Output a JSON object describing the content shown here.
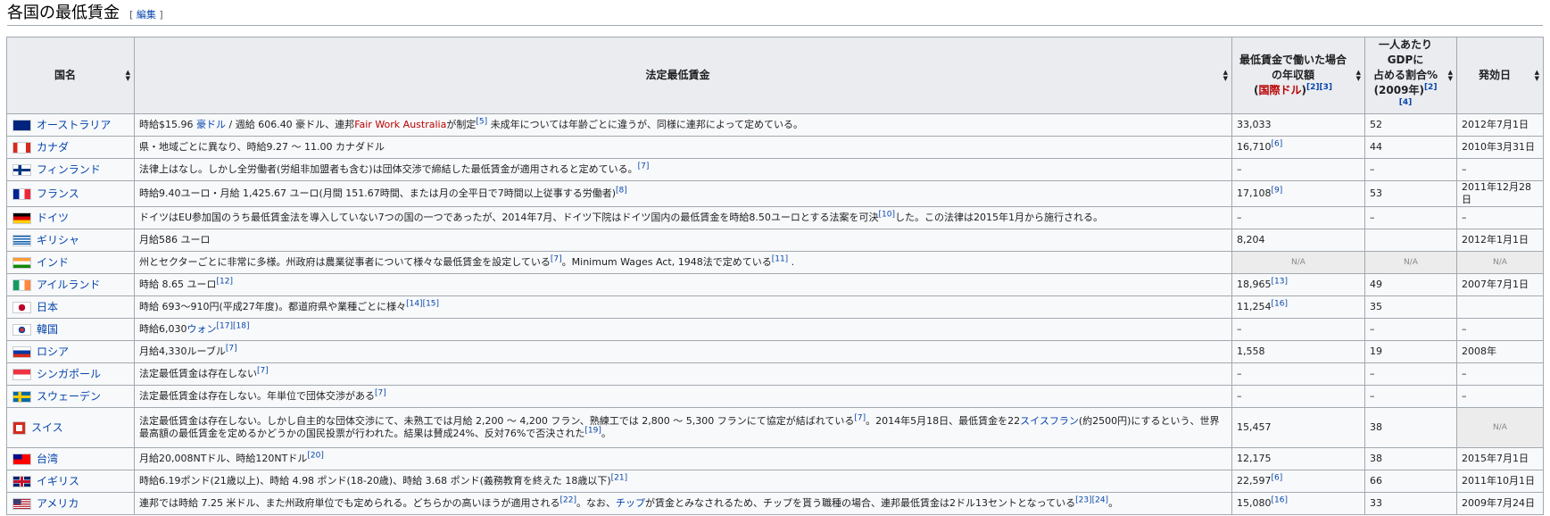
{
  "heading": {
    "title": "各国の最低賃金",
    "edit_open": "[",
    "edit_label": "編集",
    "edit_close": "]"
  },
  "table": {
    "headers": {
      "country": "国名",
      "law": "法定最低賃金",
      "annual_l1": "最低賃金で働いた場合",
      "annual_l2": "の年収額",
      "annual_l3": "国際ドル",
      "annual_ref": "[2][3]",
      "gdp_l1": "一人あたり",
      "gdp_l2": "GDPに",
      "gdp_l3": "占める割合%",
      "gdp_l4": "(2009年)",
      "gdp_ref": "[2][4]",
      "date": "発効日"
    },
    "rows": [
      {
        "flag": "australia",
        "name": "オーストラリア",
        "p1": "時給$15.96 ",
        "l1": "豪ドル",
        "p2": " / 週給 606.40 豪ドル、連邦",
        "r1": "Fair Work Australia",
        "p3": "が制定",
        "ref1": "[5]",
        "p4": " 未成年については年齢ごとに違うが、同様に連邦によって定めている。",
        "annual": "33,033",
        "gdp": "52",
        "date": "2012年7月1日"
      },
      {
        "flag": "canada",
        "name": "カナダ",
        "p1": "県・地域ごとに異なり、時給9.27 〜 11.00 カナダドル",
        "annual": "16,710",
        "annual_ref": "[6]",
        "gdp": "44",
        "date": "2010年3月31日"
      },
      {
        "flag": "finland",
        "name": "フィンランド",
        "p1": "法律上はなし。しかし全労働者(労組非加盟者も含む)は団体交渉で締結した最低賃金が適用されると定めている。",
        "ref1": "[7]",
        "annual": "–",
        "gdp": "–",
        "date": "–"
      },
      {
        "flag": "france",
        "name": "フランス",
        "p1": "時給9.40ユーロ・月給 1,425.67 ユーロ(月間 151.67時間、または月の全平日で7時間以上従事する労働者)",
        "ref1": "[8]",
        "annual": "17,108",
        "annual_ref": "[9]",
        "gdp": "53",
        "date": "2011年12月28日"
      },
      {
        "flag": "germany",
        "name": "ドイツ",
        "p1": "ドイツはEU参加国のうち最低賃金法を導入していない7つの国の一つであったが、2014年7月、ドイツ下院はドイツ国内の最低賃金を時給8.50ユーロとする法案を可決",
        "ref1": "[10]",
        "p2": "した。この法律は2015年1月から施行される。",
        "annual": "–",
        "gdp": "–",
        "date": "–"
      },
      {
        "flag": "greece",
        "name": "ギリシャ",
        "p1": "月給586 ユーロ",
        "annual": "8,204",
        "gdp": "",
        "date": "2012年1月1日"
      },
      {
        "flag": "india",
        "name": "インド",
        "p1": "州とセクターごとに非常に多様。州政府は農業従事者について様々な最低賃金を設定している",
        "ref1": "[7]",
        "p2": "。Minimum Wages Act, 1948法で定めている",
        "ref2": "[11]",
        "p3": " .",
        "annual_na": "N/A",
        "gdp_na": "N/A",
        "date_na": "N/A"
      },
      {
        "flag": "ireland",
        "name": "アイルランド",
        "p1": "時給 8.65 ユーロ",
        "ref1": "[12]",
        "annual": "18,965",
        "annual_ref": "[13]",
        "gdp": "49",
        "date": "2007年7月1日"
      },
      {
        "flag": "japan",
        "name": "日本",
        "p1": "時給 693〜910円(平成27年度)。都道府県や業種ごとに様々",
        "ref1": "[14]",
        "ref2": "[15]",
        "annual": "11,254",
        "annual_ref": "[16]",
        "gdp": "35",
        "date": ""
      },
      {
        "flag": "korea",
        "name": "韓国",
        "p1": "時給6,030",
        "l1": "ウォン",
        "ref1": "[17]",
        "ref2": "[18]",
        "annual": "–",
        "gdp": "–",
        "date": "–"
      },
      {
        "flag": "russia",
        "name": "ロシア",
        "p1": "月給4,330ルーブル",
        "ref1": "[7]",
        "annual": "1,558",
        "gdp": "19",
        "date": "2008年"
      },
      {
        "flag": "singapore",
        "name": "シンガポール",
        "p1": "法定最低賃金は存在しない",
        "ref1": "[7]",
        "annual": "–",
        "gdp": "–",
        "date": "–"
      },
      {
        "flag": "sweden",
        "name": "スウェーデン",
        "p1": "法定最低賃金は存在しない。年単位で団体交渉がある",
        "ref1": "[7]",
        "annual": "–",
        "gdp": "–",
        "date": "–"
      },
      {
        "flag": "switzerland",
        "name": "スイス",
        "p1": "法定最低賃金は存在しない。しかし自主的な団体交渉にて、未熟工では月給 2,200 〜 4,200 フラン、熟練工では 2,800 〜 5,300 フランにて協定が結ばれている",
        "ref1": "[7]",
        "p2": "。2014年5月18日、最低賃金を22",
        "l1": "スイスフラン",
        "p3": "(約2500円)にするという、世界最高額の最低賃金を定めるかどうかの国民投票が行われた。結果は賛成24%、反対76%で否決された",
        "ref2": "[19]",
        "p4": "。",
        "annual": "15,457",
        "gdp": "38",
        "date_na": "N/A"
      },
      {
        "flag": "taiwan",
        "name": "台湾",
        "p1": "月給20,008NTドル、時給120NTドル",
        "ref1": "[20]",
        "annual": "12,175",
        "gdp": "38",
        "date": "2015年7月1日"
      },
      {
        "flag": "uk",
        "name": "イギリス",
        "p1": "時給6.19ポンド(21歳以上)、時給 4.98 ポンド(18-20歳)、時給 3.68 ポンド(義務教育を終えた 18歳以下)",
        "ref1": "[21]",
        "annual": "22,597",
        "annual_ref": "[6]",
        "gdp": "66",
        "date": "2011年10月1日"
      },
      {
        "flag": "usa",
        "name": "アメリカ",
        "p1": "連邦では時給 7.25 米ドル、また州政府単位でも定められる。どちらかの高いほうが適用される",
        "ref1": "[22]",
        "p2": "。なお、",
        "l1": "チップ",
        "p3": "が賃金とみなされるため、チップを貰う職種の場合、連邦最低賃金は2ドル13セントとなっている",
        "ref2": "[23]",
        "ref3": "[24]",
        "p4": "。",
        "annual": "15,080",
        "annual_ref": "[16]",
        "gdp": "33",
        "date": "2009年7月24日"
      }
    ]
  }
}
